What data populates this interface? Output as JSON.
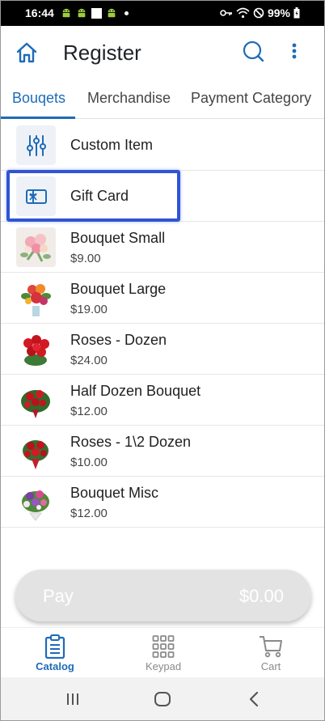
{
  "status_bar": {
    "time": "16:44",
    "battery": "99%",
    "icons": [
      "android-icon",
      "android-icon",
      "white-square-icon",
      "android-icon",
      "notification-dot-icon",
      "key-icon",
      "wifi-icon",
      "do-not-disturb-icon",
      "battery-icon"
    ]
  },
  "app_bar": {
    "title": "Register",
    "icons": [
      "home-icon",
      "search-icon",
      "more-vert-icon"
    ]
  },
  "tabs": [
    {
      "label": "Bouqets",
      "active": true
    },
    {
      "label": "Merchandise",
      "active": false
    },
    {
      "label": "Payment Category",
      "active": false
    }
  ],
  "items": [
    {
      "name": "Custom Item",
      "price": "",
      "thumb": "sliders-icon"
    },
    {
      "name": "Gift Card",
      "price": "",
      "thumb": "gift-card-icon",
      "highlighted": true
    },
    {
      "name": "Bouquet Small",
      "price": "$9.00",
      "thumb": "bouquet-small-image"
    },
    {
      "name": "Bouquet Large",
      "price": "$19.00",
      "thumb": "bouquet-large-image"
    },
    {
      "name": "Roses - Dozen",
      "price": "$24.00",
      "thumb": "roses-dozen-image"
    },
    {
      "name": "Half Dozen Bouquet",
      "price": "$12.00",
      "thumb": "half-dozen-image"
    },
    {
      "name": "Roses - 1\\2 Dozen",
      "price": "$10.00",
      "thumb": "roses-half-dozen-image"
    },
    {
      "name": "Bouquet Misc",
      "price": "$12.00",
      "thumb": "bouquet-misc-image"
    }
  ],
  "pay_button": {
    "label": "Pay",
    "amount": "$0.00"
  },
  "bottom_nav": [
    {
      "label": "Catalog",
      "icon": "clipboard-icon",
      "active": true
    },
    {
      "label": "Keypad",
      "icon": "keypad-icon",
      "active": false
    },
    {
      "label": "Cart",
      "icon": "cart-icon",
      "active": false
    }
  ],
  "colors": {
    "accent": "#1e6bb8",
    "highlight_border": "#2f55d4",
    "pay_disabled": "#e3e3e3"
  }
}
